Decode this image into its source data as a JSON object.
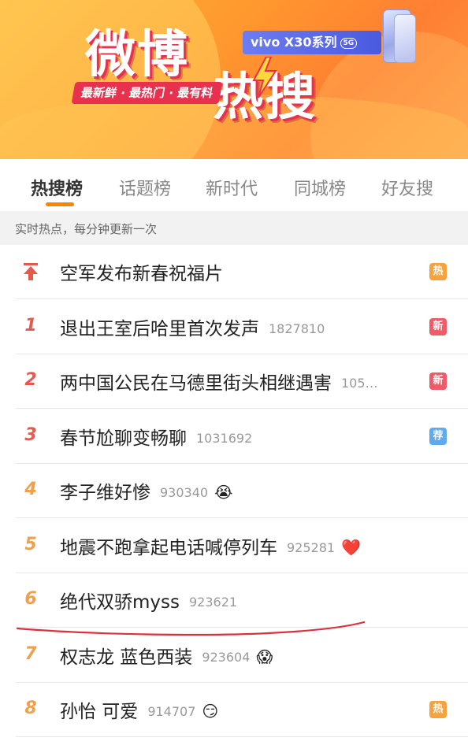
{
  "banner": {
    "logo_main": "微博",
    "logo_sub": "热搜",
    "tagline": "最新鲜 · 最热门 · 最有料",
    "sponsor_text": "vivo X30系列",
    "sponsor_badge": "5G"
  },
  "tabs": [
    {
      "label": "热搜榜",
      "active": true
    },
    {
      "label": "话题榜"
    },
    {
      "label": "新时代"
    },
    {
      "label": "同城榜"
    },
    {
      "label": "好友搜"
    }
  ],
  "notice": "实时热点，每分钟更新一次",
  "rows": [
    {
      "rank": "",
      "rank_icon": "pin-top-icon",
      "title": "空军发布新春祝福片",
      "count": "",
      "emoji": "",
      "tag": "热",
      "tag_color": "#f7a33b"
    },
    {
      "rank": "1",
      "title": "退出王室后哈里首次发声",
      "count": "1827810",
      "emoji": "",
      "tag": "新",
      "tag_color": "#f25a68"
    },
    {
      "rank": "2",
      "title": "两中国公民在马德里街头相继遇害",
      "count": "105…",
      "emoji": "",
      "tag": "新",
      "tag_color": "#f25a68"
    },
    {
      "rank": "3",
      "title": "春节尬聊变畅聊",
      "count": "1031692",
      "emoji": "",
      "tag": "荐",
      "tag_color": "#5fa9ef"
    },
    {
      "rank": "4",
      "title": "李子维好惨",
      "count": "930340",
      "emoji": "😭",
      "tag": ""
    },
    {
      "rank": "5",
      "title": "地震不跑拿起电话喊停列车",
      "count": "925281",
      "emoji": "❤️",
      "tag": ""
    },
    {
      "rank": "6",
      "title": "绝代双骄myss",
      "count": "923621",
      "emoji": "",
      "tag": ""
    },
    {
      "rank": "7",
      "title": "权志龙 蓝色西装",
      "count": "923604",
      "emoji": "😱",
      "tag": ""
    },
    {
      "rank": "8",
      "title": "孙怡 可爱",
      "count": "914707",
      "emoji": "😏",
      "tag": "热",
      "tag_color": "#f7a33b"
    }
  ],
  "colors": {
    "accent": "#ff8200",
    "rank_top": "#e55a4e",
    "rank_other": "#f0a04b",
    "handwritten_line": "#d9323c"
  }
}
